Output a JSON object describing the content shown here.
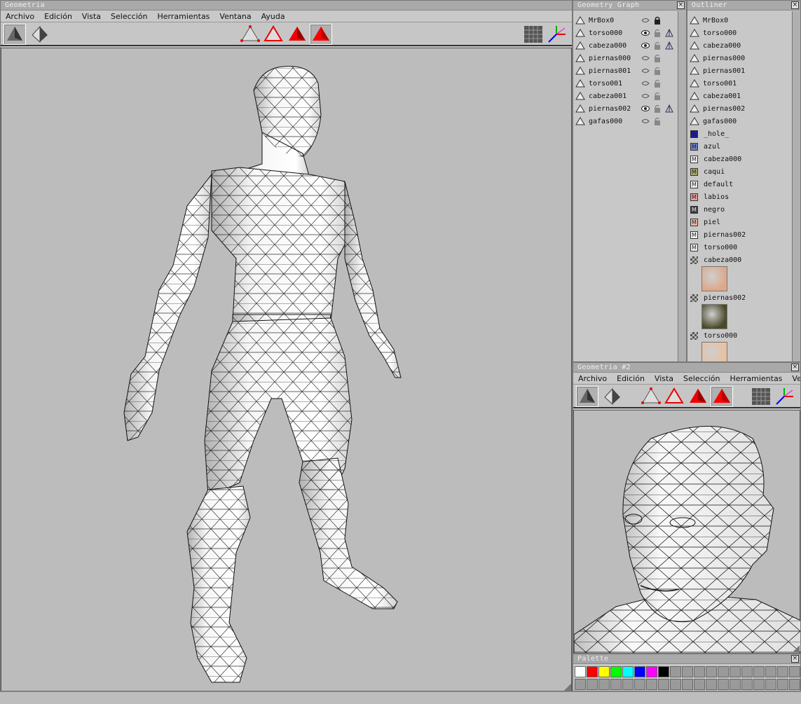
{
  "main_window": {
    "title": "Geometria",
    "menus": [
      "Archivo",
      "Edición",
      "Vista",
      "Selección",
      "Herramientas",
      "Ventana",
      "Ayuda"
    ]
  },
  "geometry_graph": {
    "title": "Geometry Graph",
    "items": [
      {
        "name": "MrBox0",
        "visible": "hidden",
        "lock": "locked",
        "extra": false
      },
      {
        "name": "torso000",
        "visible": "shown",
        "lock": "unlocked",
        "extra": true
      },
      {
        "name": "cabeza000",
        "visible": "shown",
        "lock": "unlocked",
        "extra": true
      },
      {
        "name": "piernas000",
        "visible": "hidden",
        "lock": "unlocked",
        "extra": false
      },
      {
        "name": "piernas001",
        "visible": "hidden",
        "lock": "unlocked",
        "extra": false
      },
      {
        "name": "torso001",
        "visible": "hidden",
        "lock": "unlocked",
        "extra": false
      },
      {
        "name": "cabeza001",
        "visible": "hidden",
        "lock": "unlocked",
        "extra": false
      },
      {
        "name": "piernas002",
        "visible": "shown",
        "lock": "unlocked",
        "extra": true
      },
      {
        "name": "gafas000",
        "visible": "hidden",
        "lock": "unlocked",
        "extra": false
      }
    ]
  },
  "outliner": {
    "title": "Outliner",
    "geometry": [
      "MrBox0",
      "torso000",
      "cabeza000",
      "piernas000",
      "piernas001",
      "torso001",
      "cabeza001",
      "piernas002",
      "gafas000"
    ],
    "materials": [
      {
        "name": "_hole_",
        "color": "#1a1a8c",
        "text": ""
      },
      {
        "name": "azul",
        "color": "#6a7fd0",
        "text": "M"
      },
      {
        "name": "cabeza000",
        "color": "#f4f4f4",
        "text": "M"
      },
      {
        "name": "caqui",
        "color": "#a8a86a",
        "text": "M"
      },
      {
        "name": "default",
        "color": "#f4f4f4",
        "text": "M"
      },
      {
        "name": "labios",
        "color": "#e8a0a0",
        "text": "M"
      },
      {
        "name": "negro",
        "color": "#3a3a3a",
        "text": "M"
      },
      {
        "name": "piel",
        "color": "#f0b8a0",
        "text": "M"
      },
      {
        "name": "piernas002",
        "color": "#f4f4f4",
        "text": "M"
      },
      {
        "name": "torso000",
        "color": "#f4f4f4",
        "text": "M"
      }
    ],
    "textures": [
      {
        "name": "cabeza000",
        "thumb": "#dca88a"
      },
      {
        "name": "piernas002",
        "thumb": "#4a4a2a"
      },
      {
        "name": "torso000",
        "thumb": "#e8c0a0"
      }
    ]
  },
  "second_window": {
    "title": "Geometria #2",
    "menus": [
      "Archivo",
      "Edición",
      "Vista",
      "Selección",
      "Herramientas",
      "Ven"
    ]
  },
  "palette": {
    "title": "Palette",
    "colors": [
      "#ffffff",
      "#ff0000",
      "#ffff00",
      "#00ff00",
      "#00ffff",
      "#0000ff",
      "#ff00ff",
      "#000000"
    ]
  }
}
